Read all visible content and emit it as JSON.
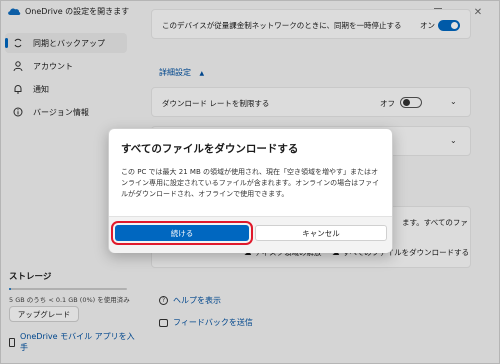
{
  "window": {
    "title": "OneDrive の設定を開きます"
  },
  "sidebar": {
    "items": [
      {
        "label": "同期とバックアップ",
        "icon": "sync-icon",
        "active": true
      },
      {
        "label": "アカウント",
        "icon": "person-icon",
        "active": false
      },
      {
        "label": "通知",
        "icon": "bell-icon",
        "active": false
      },
      {
        "label": "バージョン情報",
        "icon": "info-icon",
        "active": false
      }
    ],
    "storage": {
      "title": "ストレージ",
      "used_fraction": 0.02,
      "text": "5 GB のうち < 0.1 GB (0%) を使用済み",
      "upgrade_label": "アップグレード",
      "mobile_link": "OneDrive モバイル アプリを入手"
    }
  },
  "main": {
    "metered_text": "このデバイスが従量課金制ネットワークのときに、同期を一時停止する",
    "metered_state": "オン",
    "advanced_label": "詳細設定",
    "download_rate_label": "ダウンロード レートを制限する",
    "download_rate_state": "オフ",
    "files_on_demand_partial": "ます。すべてのファ",
    "free_space_button": "ディスク領域の解放",
    "download_all_button": "すべてのファイルをダウンロードする",
    "help_link": "ヘルプを表示",
    "feedback_link": "フィードバックを送信"
  },
  "dialog": {
    "title": "すべてのファイルをダウンロードする",
    "body": "この PC では最大 21 MB の領域が使用され、現在「空き領域を増やす」またはオンライン専用に設定されているファイルが含まれます。オンラインの場合はファイルがダウンロードされ、オフラインで使用できます。",
    "continue_label": "続ける",
    "cancel_label": "キャンセル"
  },
  "colors": {
    "accent": "#0067c0",
    "highlight": "#e0192b"
  }
}
